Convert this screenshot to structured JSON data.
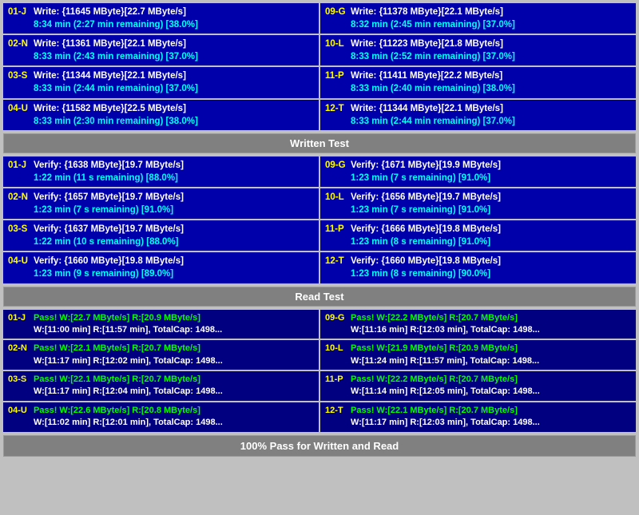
{
  "sections": {
    "write_test": {
      "label": "Written Test",
      "left": [
        {
          "id": "01-J",
          "line1": "Write: {11645 MByte}[22.7 MByte/s]",
          "line2": "8:34 min (2:27 min remaining)  [38.0%]"
        },
        {
          "id": "02-N",
          "line1": "Write: {11361 MByte}[22.1 MByte/s]",
          "line2": "8:33 min (2:43 min remaining)  [37.0%]"
        },
        {
          "id": "03-S",
          "line1": "Write: {11344 MByte}[22.1 MByte/s]",
          "line2": "8:33 min (2:44 min remaining)  [37.0%]"
        },
        {
          "id": "04-U",
          "line1": "Write: {11582 MByte}[22.5 MByte/s]",
          "line2": "8:33 min (2:30 min remaining)  [38.0%]"
        }
      ],
      "right": [
        {
          "id": "09-G",
          "line1": "Write: {11378 MByte}[22.1 MByte/s]",
          "line2": "8:32 min (2:45 min remaining)  [37.0%]"
        },
        {
          "id": "10-L",
          "line1": "Write: {11223 MByte}[21.8 MByte/s]",
          "line2": "8:33 min (2:52 min remaining)  [37.0%]"
        },
        {
          "id": "11-P",
          "line1": "Write: {11411 MByte}[22.2 MByte/s]",
          "line2": "8:33 min (2:40 min remaining)  [38.0%]"
        },
        {
          "id": "12-T",
          "line1": "Write: {11344 MByte}[22.1 MByte/s]",
          "line2": "8:33 min (2:44 min remaining)  [37.0%]"
        }
      ]
    },
    "verify_test": {
      "label": "Written Test",
      "left": [
        {
          "id": "01-J",
          "line1": "Verify: {1638 MByte}[19.7 MByte/s]",
          "line2": "1:22 min (11 s remaining)   [88.0%]"
        },
        {
          "id": "02-N",
          "line1": "Verify: {1657 MByte}[19.7 MByte/s]",
          "line2": "1:23 min (7 s remaining)   [91.0%]"
        },
        {
          "id": "03-S",
          "line1": "Verify: {1637 MByte}[19.7 MByte/s]",
          "line2": "1:22 min (10 s remaining)   [88.0%]"
        },
        {
          "id": "04-U",
          "line1": "Verify: {1660 MByte}[19.8 MByte/s]",
          "line2": "1:23 min (9 s remaining)   [89.0%]"
        }
      ],
      "right": [
        {
          "id": "09-G",
          "line1": "Verify: {1671 MByte}[19.9 MByte/s]",
          "line2": "1:23 min (7 s remaining)   [91.0%]"
        },
        {
          "id": "10-L",
          "line1": "Verify: {1656 MByte}[19.7 MByte/s]",
          "line2": "1:23 min (7 s remaining)   [91.0%]"
        },
        {
          "id": "11-P",
          "line1": "Verify: {1666 MByte}[19.8 MByte/s]",
          "line2": "1:23 min (8 s remaining)   [91.0%]"
        },
        {
          "id": "12-T",
          "line1": "Verify: {1660 MByte}[19.8 MByte/s]",
          "line2": "1:23 min (8 s remaining)   [90.0%]"
        }
      ]
    },
    "read_test": {
      "label": "Read Test",
      "left": [
        {
          "id": "01-J",
          "line1": "Pass! W:[22.7 MByte/s] R:[20.9 MByte/s]",
          "line2": "W:[11:00 min] R:[11:57 min], TotalCap: 1498..."
        },
        {
          "id": "02-N",
          "line1": "Pass! W:[22.1 MByte/s] R:[20.7 MByte/s]",
          "line2": "W:[11:17 min] R:[12:02 min], TotalCap: 1498..."
        },
        {
          "id": "03-S",
          "line1": "Pass! W:[22.1 MByte/s] R:[20.7 MByte/s]",
          "line2": "W:[11:17 min] R:[12:04 min], TotalCap: 1498..."
        },
        {
          "id": "04-U",
          "line1": "Pass! W:[22.6 MByte/s] R:[20.8 MByte/s]",
          "line2": "W:[11:02 min] R:[12:01 min], TotalCap: 1498..."
        }
      ],
      "right": [
        {
          "id": "09-G",
          "line1": "Pass! W:[22.2 MByte/s] R:[20.7 MByte/s]",
          "line2": "W:[11:16 min] R:[12:03 min], TotalCap: 1498..."
        },
        {
          "id": "10-L",
          "line1": "Pass! W:[21.9 MByte/s] R:[20.9 MByte/s]",
          "line2": "W:[11:24 min] R:[11:57 min], TotalCap: 1498..."
        },
        {
          "id": "11-P",
          "line1": "Pass! W:[22.2 MByte/s] R:[20.7 MByte/s]",
          "line2": "W:[11:14 min] R:[12:05 min], TotalCap: 1498..."
        },
        {
          "id": "12-T",
          "line1": "Pass! W:[22.1 MByte/s] R:[20.7 MByte/s]",
          "line2": "W:[11:17 min] R:[12:03 min], TotalCap: 1498..."
        }
      ]
    }
  },
  "footer": "100% Pass for Written and Read"
}
